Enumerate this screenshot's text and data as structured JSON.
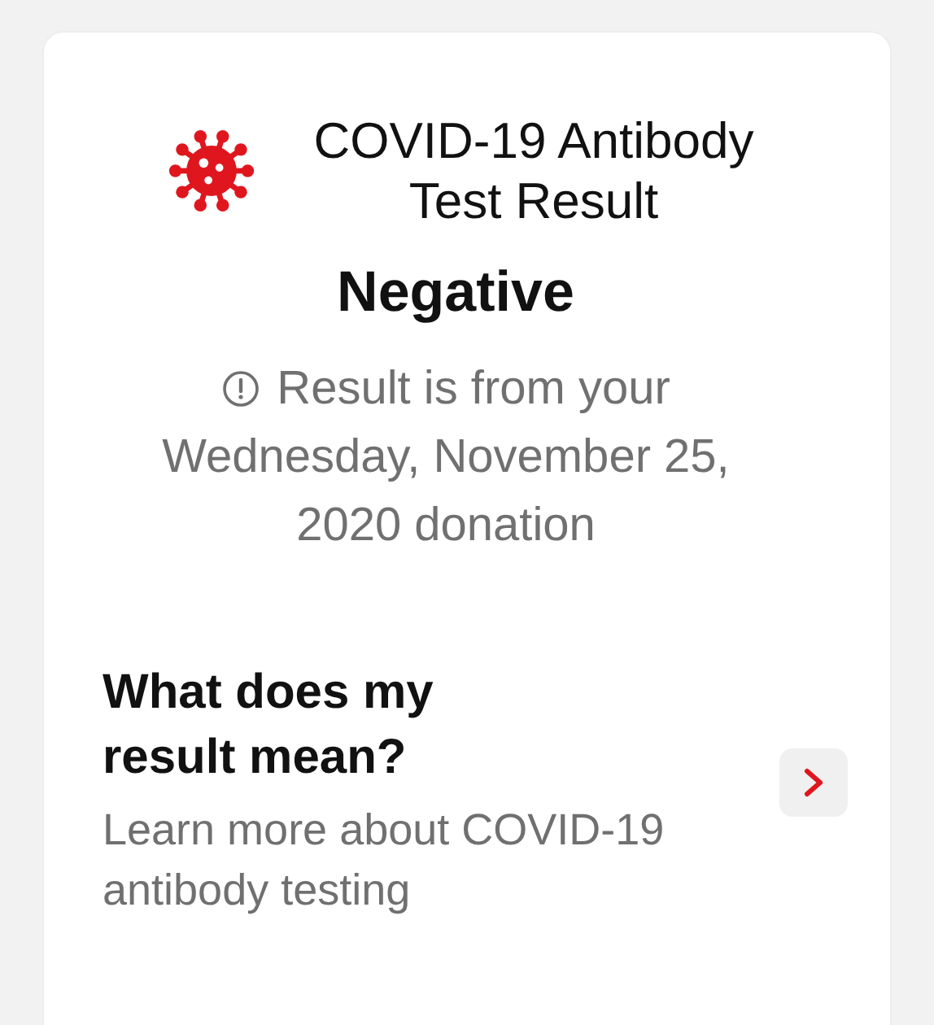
{
  "header": {
    "title": "COVID-19 Antibody Test Result"
  },
  "result": "Negative",
  "note": "Result is from your Wednesday, November 25, 2020 donation",
  "link": {
    "title": "What does my result mean?",
    "subtitle": "Learn more about COVID-19 antibody testing"
  }
}
